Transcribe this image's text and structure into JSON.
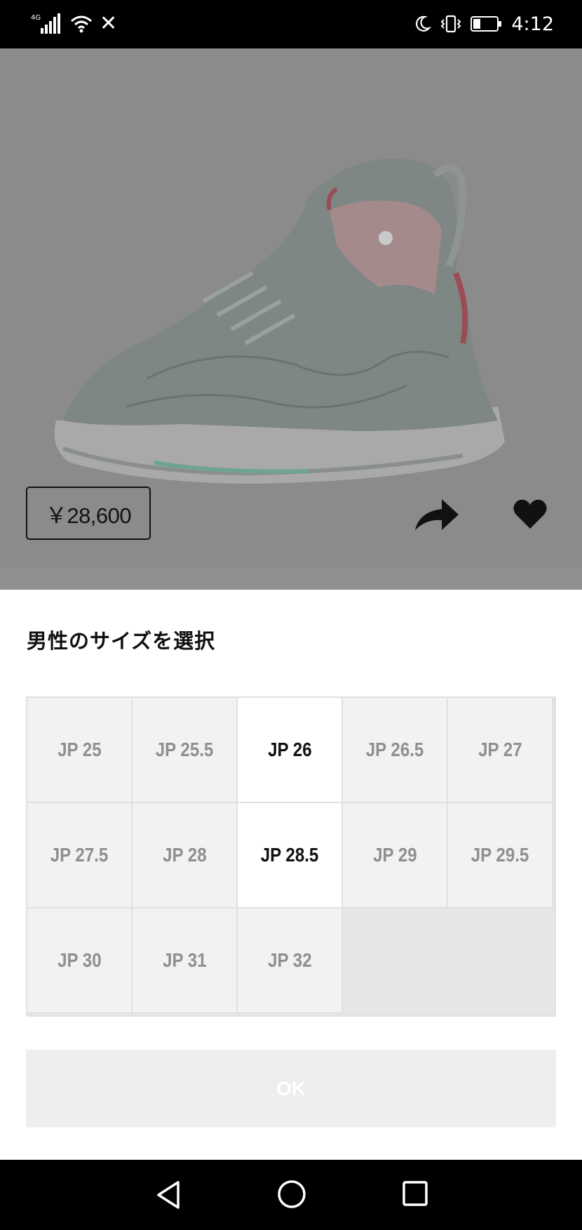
{
  "status_bar": {
    "network_label": "4G",
    "carrier_icon": "x-icon",
    "time": "4:12"
  },
  "product": {
    "image_alt": "sneaker",
    "price": "￥28,600"
  },
  "size_sheet": {
    "title": "男性のサイズを選択",
    "sizes": [
      {
        "label": "JP 25",
        "available": false
      },
      {
        "label": "JP 25.5",
        "available": false
      },
      {
        "label": "JP 26",
        "available": true
      },
      {
        "label": "JP 26.5",
        "available": false
      },
      {
        "label": "JP 27",
        "available": false
      },
      {
        "label": "JP 27.5",
        "available": false
      },
      {
        "label": "JP 28",
        "available": false
      },
      {
        "label": "JP 28.5",
        "available": true
      },
      {
        "label": "JP 29",
        "available": false
      },
      {
        "label": "JP 29.5",
        "available": false
      },
      {
        "label": "JP 30",
        "available": false
      },
      {
        "label": "JP 31",
        "available": false
      },
      {
        "label": "JP 32",
        "available": false
      }
    ],
    "ok_label": "OK"
  },
  "colors": {
    "overlay_grey": "#8b8b8b",
    "cell_unavailable": "#f2f2f2",
    "cell_available": "#ffffff",
    "text_unavailable": "#8f8f8f",
    "text_available": "#111111",
    "ok_disabled_bg": "#eeeeee"
  }
}
